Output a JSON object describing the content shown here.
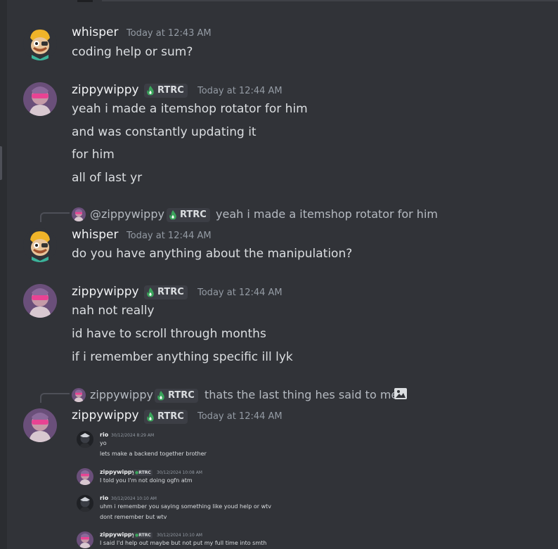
{
  "colors": {
    "background": "#313338",
    "username": "#f2f3f5",
    "timestamp": "#949ba4",
    "text": "#dbdee1",
    "badge_bg": "#3c3e45",
    "flame": "#3ba55c"
  },
  "messages": [
    {
      "author": "whisper",
      "timestamp": "Today at 12:43 AM",
      "avatar_icon": "cartoon-character-avatar-icon",
      "lines": [
        "coding help or sum?"
      ]
    },
    {
      "author": "zippywippy",
      "badge": "RTRC",
      "timestamp": "Today at 12:44 AM",
      "avatar_icon": "pink-sunglasses-avatar-icon",
      "lines": [
        "yeah i made a itemshop rotator for him",
        "and was constantly updating it",
        "for him",
        "all of last yr"
      ]
    },
    {
      "reply": {
        "author": "@zippywippy",
        "badge": "RTRC",
        "text": "yeah i made a itemshop rotator for him"
      },
      "author": "whisper",
      "timestamp": "Today at 12:44 AM",
      "avatar_icon": "cartoon-character-avatar-icon",
      "lines": [
        "do you have anything about the manipulation?"
      ]
    },
    {
      "author": "zippywippy",
      "badge": "RTRC",
      "timestamp": "Today at 12:44 AM",
      "avatar_icon": "pink-sunglasses-avatar-icon",
      "lines": [
        "nah not really",
        "id have to scroll through months",
        "if i remember anything specific ill lyk"
      ]
    },
    {
      "reply": {
        "author": "zippywippy",
        "badge": "RTRC",
        "text": "thats the last thing hes said to me",
        "icon": "image-icon"
      },
      "author": "zippywippy",
      "badge": "RTRC",
      "timestamp": "Today at 12:44 AM",
      "avatar_icon": "pink-sunglasses-avatar-icon",
      "attachment": [
        {
          "author": "rio",
          "timestamp": "30/12/2024 8:29 AM",
          "lines": [
            "yo",
            "lets make a backend together brother"
          ]
        },
        {
          "author": "zippywippy",
          "badge": "RTRC",
          "timestamp": "30/12/2024 10:08 AM",
          "lines": [
            "I told you I'm not doing ogfn atm"
          ]
        },
        {
          "author": "rio",
          "timestamp": "30/12/2024 10:10 AM",
          "lines": [
            "uhm i remember you saying something like youd help or wtv",
            "dont remember but wtv"
          ]
        },
        {
          "author": "zippywippy",
          "badge": "RTRC",
          "timestamp": "30/12/2024 10:10 AM",
          "lines": [
            "I said I'd help out maybe but not put my full time into smth"
          ]
        }
      ]
    }
  ]
}
